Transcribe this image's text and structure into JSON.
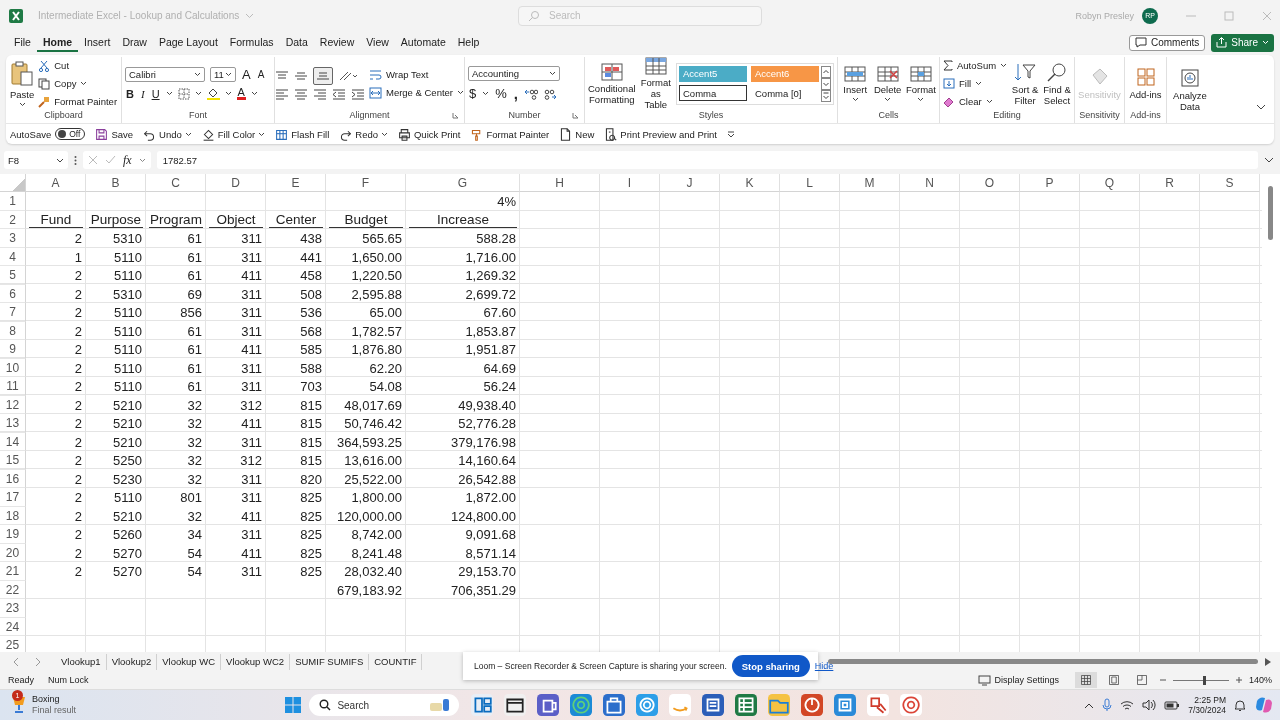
{
  "window": {
    "title": "Intermediate Excel - Lookup and Calculations",
    "search": {
      "placeholder": "Search"
    },
    "user": "Robyn Presley",
    "avatar": "RP"
  },
  "menu_tabs": [
    {
      "label": "File",
      "selected": false
    },
    {
      "label": "Home",
      "selected": true
    },
    {
      "label": "Insert",
      "selected": false
    },
    {
      "label": "Draw",
      "selected": false
    },
    {
      "label": "Page Layout",
      "selected": false
    },
    {
      "label": "Formulas",
      "selected": false
    },
    {
      "label": "Data",
      "selected": false
    },
    {
      "label": "Review",
      "selected": false
    },
    {
      "label": "View",
      "selected": false
    },
    {
      "label": "Automate",
      "selected": false
    },
    {
      "label": "Help",
      "selected": false
    }
  ],
  "comments_button": "Comments",
  "share_button": "Share",
  "ribbon": {
    "clipboard": {
      "label": "Clipboard",
      "paste": "Paste",
      "cut": "Cut",
      "copy": "Copy",
      "format_painter": "Format Painter"
    },
    "font": {
      "label": "Font",
      "name": "Calibri",
      "size": "11",
      "grow": "A",
      "shrink": "A",
      "bold": "B",
      "italic": "I",
      "underline": "U",
      "font_color": "A"
    },
    "alignment": {
      "label": "Alignment",
      "wrap_text": "Wrap Text",
      "merge": "Merge & Center"
    },
    "number": {
      "label": "Number",
      "format": "Accounting",
      "currency": "$",
      "percent": "%",
      "comma": ","
    },
    "styles": {
      "label": "Styles",
      "conditional": "Conditional Formatting",
      "format_table": "Format as Table",
      "cell_styles": [
        {
          "label": "Accent5",
          "color": "#4bacc6",
          "selected": false
        },
        {
          "label": "Accent6",
          "color": "#f79646",
          "selected": false
        },
        {
          "label": "Comma",
          "selected": true
        },
        {
          "label": "Comma [0]",
          "selected": false
        }
      ]
    },
    "cells": {
      "label": "Cells",
      "insert": "Insert",
      "delete": "Delete",
      "format": "Format"
    },
    "editing": {
      "label": "Editing",
      "autosum": "AutoSum",
      "fill": "Fill",
      "clear": "Clear",
      "sort_filter": "Sort & Filter",
      "find_select": "Find & Select"
    },
    "sensitivity": {
      "label": "Sensitivity",
      "button": "Sensitivity",
      "disabled": true
    },
    "addins": {
      "label": "Add-ins",
      "button": "Add-ins"
    },
    "analyze": {
      "button": "Analyze Data"
    }
  },
  "quick_access": {
    "autosave": {
      "label": "AutoSave",
      "state": "Off",
      "on": false
    },
    "commands": [
      {
        "label": "Save",
        "kind": "save",
        "dropdown": false
      },
      {
        "label": "Undo",
        "kind": "undo",
        "dropdown": true
      },
      {
        "label": "Fill Color",
        "kind": "fill",
        "dropdown": true
      },
      {
        "label": "Flash Fill",
        "kind": "flash",
        "dropdown": false
      },
      {
        "label": "Redo",
        "kind": "redo",
        "dropdown": true
      },
      {
        "label": "Quick Print",
        "kind": "print",
        "dropdown": false
      },
      {
        "label": "Format Painter",
        "kind": "brush",
        "dropdown": false
      },
      {
        "label": "New",
        "kind": "new",
        "dropdown": false
      },
      {
        "label": "Print Preview and Print",
        "kind": "preview",
        "dropdown": false
      }
    ]
  },
  "formula_bar": {
    "cell_ref": "F8",
    "fx": "fx",
    "value": "1782.57"
  },
  "sheet": {
    "columns": [
      "A",
      "B",
      "C",
      "D",
      "E",
      "F",
      "G",
      "H",
      "I",
      "J",
      "K",
      "L",
      "M",
      "N",
      "O",
      "P",
      "Q",
      "R",
      "S"
    ],
    "rows": [
      {
        "number": "1",
        "kind": "rate",
        "increase": "4%"
      },
      {
        "number": "2",
        "kind": "header",
        "values": [
          "Fund",
          "Purpose",
          "Program",
          "Object",
          "Center",
          "Budget",
          "Increase"
        ]
      },
      {
        "number": "3",
        "kind": "data",
        "values": [
          "2",
          "5310",
          "61",
          "311",
          "438",
          "565.65",
          "588.28"
        ]
      },
      {
        "number": "4",
        "kind": "data",
        "values": [
          "1",
          "5110",
          "61",
          "311",
          "441",
          "1,650.00",
          "1,716.00"
        ]
      },
      {
        "number": "5",
        "kind": "data",
        "values": [
          "2",
          "5110",
          "61",
          "411",
          "458",
          "1,220.50",
          "1,269.32"
        ]
      },
      {
        "number": "6",
        "kind": "data",
        "values": [
          "2",
          "5310",
          "69",
          "311",
          "508",
          "2,595.88",
          "2,699.72"
        ]
      },
      {
        "number": "7",
        "kind": "data",
        "values": [
          "2",
          "5110",
          "856",
          "311",
          "536",
          "65.00",
          "67.60"
        ]
      },
      {
        "number": "8",
        "kind": "data",
        "values": [
          "2",
          "5110",
          "61",
          "311",
          "568",
          "1,782.57",
          "1,853.87"
        ]
      },
      {
        "number": "9",
        "kind": "data",
        "values": [
          "2",
          "5110",
          "61",
          "411",
          "585",
          "1,876.80",
          "1,951.87"
        ]
      },
      {
        "number": "10",
        "kind": "data",
        "values": [
          "2",
          "5110",
          "61",
          "311",
          "588",
          "62.20",
          "64.69"
        ]
      },
      {
        "number": "11",
        "kind": "data",
        "values": [
          "2",
          "5110",
          "61",
          "311",
          "703",
          "54.08",
          "56.24"
        ]
      },
      {
        "number": "12",
        "kind": "data",
        "values": [
          "2",
          "5210",
          "32",
          "312",
          "815",
          "48,017.69",
          "49,938.40"
        ]
      },
      {
        "number": "13",
        "kind": "data",
        "values": [
          "2",
          "5210",
          "32",
          "411",
          "815",
          "50,746.42",
          "52,776.28"
        ]
      },
      {
        "number": "14",
        "kind": "data",
        "values": [
          "2",
          "5210",
          "32",
          "311",
          "815",
          "364,593.25",
          "379,176.98"
        ]
      },
      {
        "number": "15",
        "kind": "data",
        "values": [
          "2",
          "5250",
          "32",
          "312",
          "815",
          "13,616.00",
          "14,160.64"
        ]
      },
      {
        "number": "16",
        "kind": "data",
        "values": [
          "2",
          "5230",
          "32",
          "311",
          "820",
          "25,522.00",
          "26,542.88"
        ]
      },
      {
        "number": "17",
        "kind": "data",
        "values": [
          "2",
          "5110",
          "801",
          "311",
          "825",
          "1,800.00",
          "1,872.00"
        ]
      },
      {
        "number": "18",
        "kind": "data",
        "values": [
          "2",
          "5210",
          "32",
          "411",
          "825",
          "120,000.00",
          "124,800.00"
        ]
      },
      {
        "number": "19",
        "kind": "data",
        "values": [
          "2",
          "5260",
          "34",
          "311",
          "825",
          "8,742.00",
          "9,091.68"
        ]
      },
      {
        "number": "20",
        "kind": "data",
        "values": [
          "2",
          "5270",
          "54",
          "411",
          "825",
          "8,241.48",
          "8,571.14"
        ]
      },
      {
        "number": "21",
        "kind": "data",
        "values": [
          "2",
          "5270",
          "54",
          "311",
          "825",
          "28,032.40",
          "29,153.70"
        ]
      },
      {
        "number": "22",
        "kind": "total",
        "budget": "679,183.92",
        "increase": "706,351.29"
      },
      {
        "number": "23",
        "kind": "empty"
      },
      {
        "number": "24",
        "kind": "empty"
      },
      {
        "number": "25",
        "kind": "empty"
      }
    ]
  },
  "sheet_tabs": [
    {
      "label": "Vlookup1",
      "selected": false
    },
    {
      "label": "Vlookup2",
      "selected": false
    },
    {
      "label": "Vlookup WC",
      "selected": false
    },
    {
      "label": "Vlookup WC2",
      "selected": false
    },
    {
      "label": "SUMIF SUMIFS",
      "selected": false
    },
    {
      "label": "COUNTIF",
      "selected": false
    }
  ],
  "screen_share_notice": {
    "message": "Loom – Screen Recorder & Screen Capture is sharing your screen.",
    "stop_button": "Stop sharing",
    "hide_link": "Hide"
  },
  "status_bar": {
    "mode": "Ready",
    "num_lock": "Num Lock",
    "display_settings": "Display Settings",
    "views": [
      {
        "kind": "normal",
        "selected": true
      },
      {
        "kind": "page_layout",
        "selected": false
      },
      {
        "kind": "page_break",
        "selected": false
      }
    ],
    "zoom": {
      "level": 0.55,
      "reading": "140%"
    }
  },
  "taskbar": {
    "notification": {
      "badge": "1",
      "title": "Boxing",
      "subtitle": "Final result"
    },
    "search": {
      "placeholder": "Search"
    },
    "time": "2:25 PM",
    "date": "7/30/2024"
  }
}
